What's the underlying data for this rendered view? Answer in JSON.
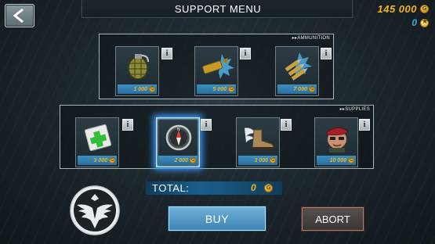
{
  "header": {
    "title": "SUPPORT MENU",
    "currency": "145 000",
    "stars": "0"
  },
  "ammunition": {
    "label": "▸▸AMMUNITION",
    "items": [
      {
        "name": "grenade",
        "price": "1 000"
      },
      {
        "name": "artillery-shell",
        "price": "5 000"
      },
      {
        "name": "bullets",
        "price": "7 000"
      }
    ]
  },
  "supplies": {
    "label": "▸▸SUPPLIES",
    "items": [
      {
        "name": "medkit",
        "price": "3 000"
      },
      {
        "name": "compass",
        "price": "2 000",
        "selected": true
      },
      {
        "name": "winged-boot",
        "price": "3 000"
      },
      {
        "name": "soldier-beret",
        "price": "10 000"
      }
    ]
  },
  "total": {
    "label": "TOTAL:",
    "value": "0"
  },
  "buttons": {
    "buy": "BUY",
    "abort": "ABORT"
  },
  "info_label": "i",
  "coin_glyph": "G",
  "colors": {
    "gold": "#f2b320",
    "accent_blue": "#3b9cff",
    "buy": "#4f97c4",
    "abort": "#48423f"
  }
}
